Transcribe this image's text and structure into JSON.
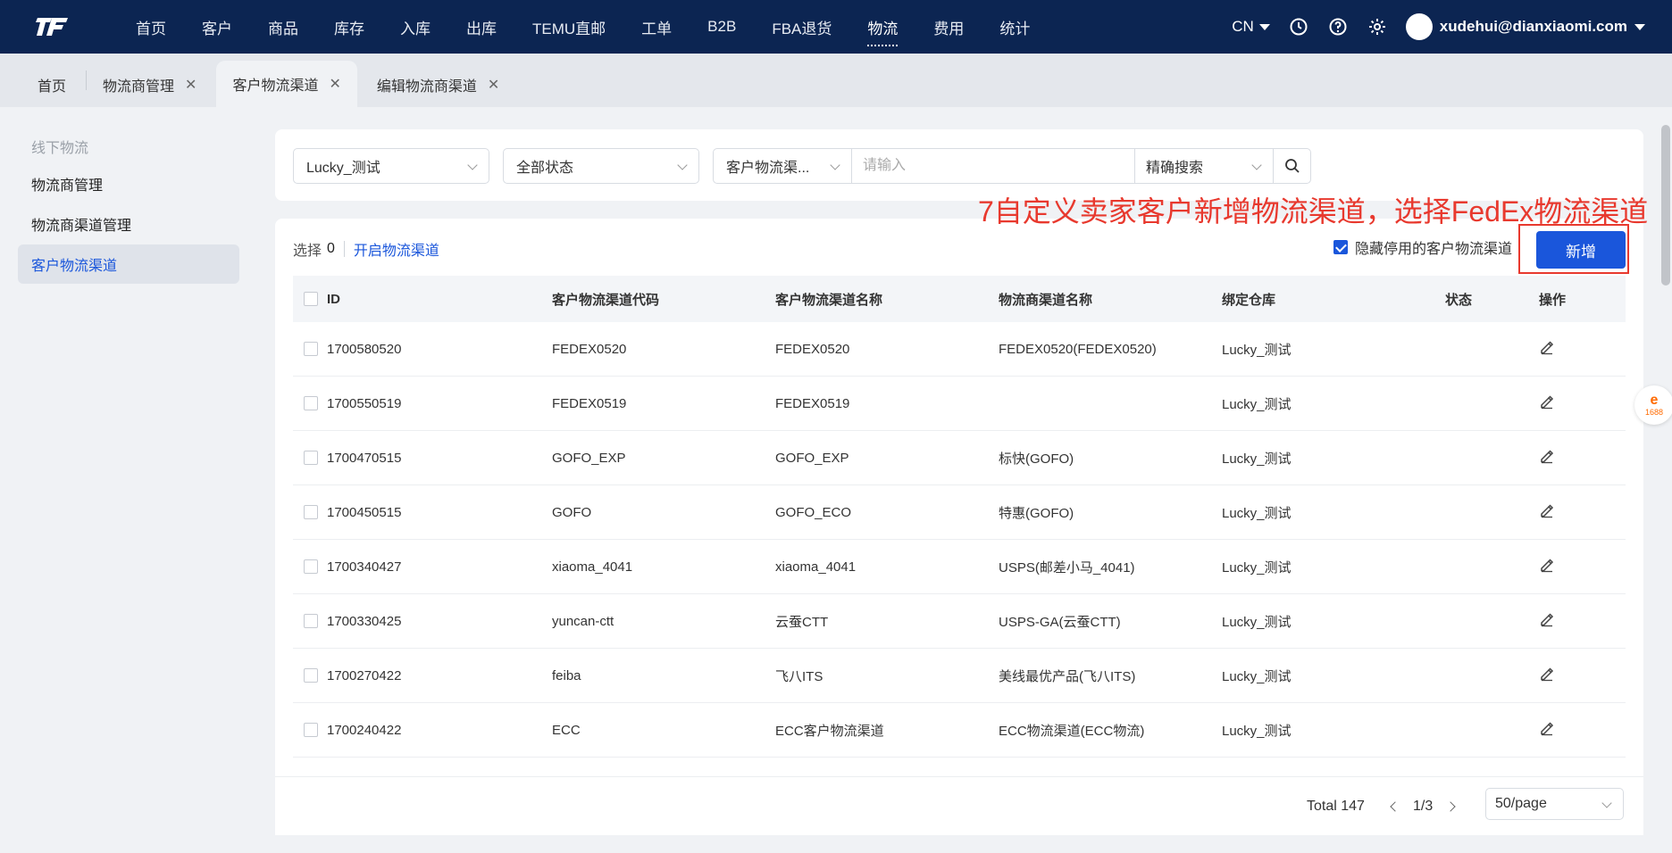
{
  "nav": {
    "items": [
      "首页",
      "客户",
      "商品",
      "库存",
      "入库",
      "出库",
      "TEMU直邮",
      "工单",
      "B2B",
      "FBA退货",
      "物流",
      "费用",
      "统计"
    ],
    "active_index": 10,
    "lang": "CN",
    "user": "xudehui@dianxiaomi.com",
    "icons": [
      "clock-icon",
      "help-icon",
      "gear-icon"
    ]
  },
  "tabs": [
    {
      "label": "首页",
      "closable": false
    },
    {
      "label": "物流商管理",
      "closable": true
    },
    {
      "label": "客户物流渠道",
      "closable": true,
      "active": true
    },
    {
      "label": "编辑物流商渠道",
      "closable": true
    }
  ],
  "sidebar": {
    "group": "线下物流",
    "items": [
      "物流商管理",
      "物流商渠道管理",
      "客户物流渠道"
    ],
    "active_index": 2
  },
  "filters": {
    "warehouse": "Lucky_测试",
    "status": "全部状态",
    "search_field": "客户物流渠...",
    "search_placeholder": "请输入",
    "search_mode": "精确搜索"
  },
  "annotation": "7自定义卖家客户新增物流渠道，选择FedEx物流渠道",
  "toolbar": {
    "select_label": "选择",
    "select_count": "0",
    "enable_link": "开启物流渠道",
    "hide_disabled_label": "隐藏停用的客户物流渠道",
    "hide_disabled_checked": true,
    "add_button": "新增"
  },
  "table": {
    "headers": [
      "ID",
      "客户物流渠道代码",
      "客户物流渠道名称",
      "物流商渠道名称",
      "绑定仓库",
      "状态",
      "操作"
    ],
    "rows": [
      {
        "id": "1700580520",
        "code": "FEDEX0520",
        "name": "FEDEX0520",
        "carrier": "FEDEX0520(FEDEX0520)",
        "warehouse": "Lucky_测试",
        "enabled": true
      },
      {
        "id": "1700550519",
        "code": "FEDEX0519",
        "name": "FEDEX0519",
        "carrier": "",
        "warehouse": "Lucky_测试",
        "enabled": true
      },
      {
        "id": "1700470515",
        "code": "GOFO_EXP",
        "name": "GOFO_EXP",
        "carrier": "标快(GOFO)",
        "warehouse": "Lucky_测试",
        "enabled": true
      },
      {
        "id": "1700450515",
        "code": "GOFO",
        "name": "GOFO_ECO",
        "carrier": "特惠(GOFO)",
        "warehouse": "Lucky_测试",
        "enabled": true
      },
      {
        "id": "1700340427",
        "code": "xiaoma_4041",
        "name": "xiaoma_4041",
        "carrier": "USPS(邮差小马_4041)",
        "warehouse": "Lucky_测试",
        "enabled": true
      },
      {
        "id": "1700330425",
        "code": "yuncan-ctt",
        "name": "云蚕CTT",
        "carrier": "USPS-GA(云蚕CTT)",
        "warehouse": "Lucky_测试",
        "enabled": true
      },
      {
        "id": "1700270422",
        "code": "feiba",
        "name": "飞八ITS",
        "carrier": "美线最优产品(飞八ITS)",
        "warehouse": "Lucky_测试",
        "enabled": true
      },
      {
        "id": "1700240422",
        "code": "ECC",
        "name": "ECC客户物流渠道",
        "carrier": "ECC物流渠道(ECC物流)",
        "warehouse": "Lucky_测试",
        "enabled": true
      }
    ]
  },
  "pagination": {
    "total": "Total 147",
    "page": "1/3",
    "page_size": "50/page"
  },
  "float_badge": {
    "line1": "e",
    "line2": "1688"
  },
  "colors": {
    "nav_bg": "#0c2552",
    "primary": "#1a56db",
    "toggle_on": "#19a64a",
    "annotation": "#e8392e"
  }
}
